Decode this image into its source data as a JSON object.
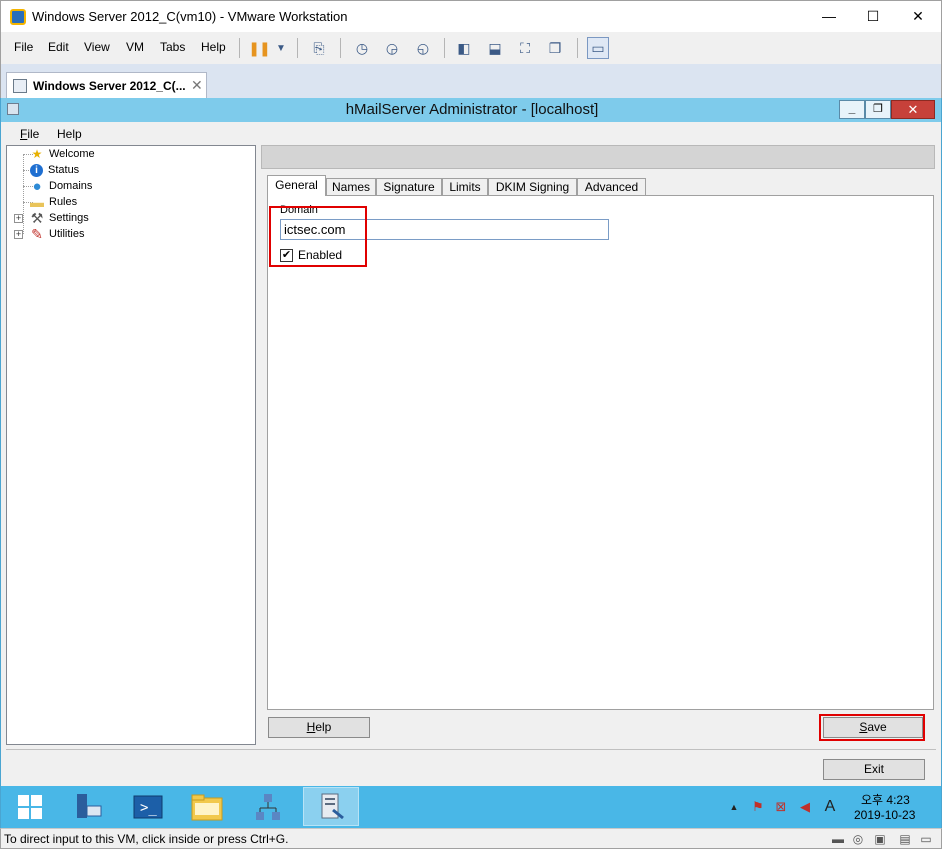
{
  "vmware": {
    "window_title": "Windows Server 2012_C(vm10) - VMware Workstation",
    "menu": [
      "File",
      "Edit",
      "View",
      "VM",
      "Tabs",
      "Help"
    ],
    "tab_label": "Windows Server 2012_C(...",
    "status_text": "To direct input to this VM, click inside or press Ctrl+G."
  },
  "hmail": {
    "window_title": "hMailServer Administrator - [localhost]",
    "menu": [
      {
        "label": "File",
        "underline": "F",
        "rest": "ile"
      },
      {
        "label": "Help"
      }
    ],
    "tree": [
      {
        "label": "Welcome",
        "icon": "star-icon",
        "glyph": "★",
        "color": "#e8b100"
      },
      {
        "label": "Status",
        "icon": "info-icon",
        "glyph": "i",
        "color": "#1f6fd1"
      },
      {
        "label": "Domains",
        "icon": "globe-icon",
        "glyph": "●",
        "color": "#2e8bd6"
      },
      {
        "label": "Rules",
        "icon": "folder-icon",
        "glyph": "▬",
        "color": "#e9c45a"
      },
      {
        "label": "Settings",
        "icon": "tools-icon",
        "glyph": "⚒",
        "color": "#555555"
      },
      {
        "label": "Utilities",
        "icon": "utilities-icon",
        "glyph": "✎",
        "color": "#c0302a"
      }
    ],
    "tabs": [
      "General",
      "Names",
      "Signature",
      "Limits",
      "DKIM Signing",
      "Advanced"
    ],
    "active_tab": "General",
    "domain_label": "Domain",
    "domain_value": "ictsec.com",
    "enabled_label": "Enabled",
    "enabled_checked": true,
    "help_button": {
      "underline": "H",
      "rest": "elp"
    },
    "save_button": {
      "underline": "S",
      "rest": "ave"
    },
    "exit_button": "Exit"
  },
  "taskbar": {
    "apps": [
      "start",
      "server-manager",
      "powershell",
      "file-explorer",
      "network",
      "hmailserver-admin"
    ],
    "clock_time": "오후 4:23",
    "clock_date": "2019-10-23",
    "ime_indicator": "A"
  },
  "colors": {
    "hmail_titlebar": "#7ecbeb",
    "taskbar": "#49b7e7",
    "highlight_box": "#e00000"
  }
}
